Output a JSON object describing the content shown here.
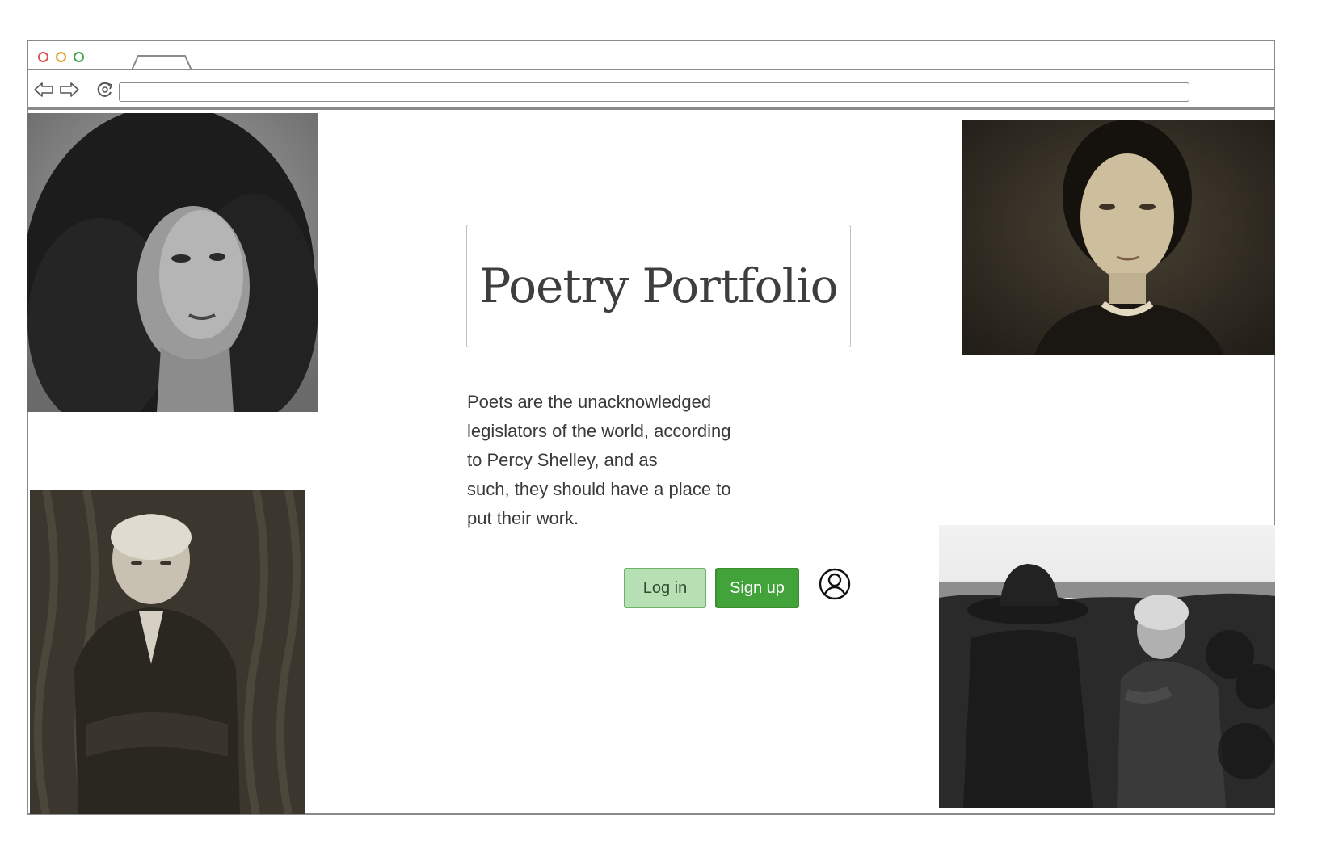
{
  "browser": {
    "window_controls": [
      "close",
      "minimize",
      "maximize"
    ],
    "nav_icons": [
      "back-arrow-icon",
      "forward-arrow-icon",
      "reload-icon"
    ],
    "url": ""
  },
  "hero": {
    "title": "Poetry Portfolio",
    "description_lines": [
      "Poets are the unacknowledged",
      "legislators of the world, according",
      "to Percy Shelley, and as",
      "such, they should have a place to",
      "put their work."
    ]
  },
  "actions": {
    "login_label": "Log in",
    "signup_label": "Sign up",
    "account_icon": "user-circle-icon"
  },
  "photos": [
    {
      "name": "portrait-curly-hair-woman",
      "style": "grayscale"
    },
    {
      "name": "portrait-victorian-woman",
      "style": "sepia"
    },
    {
      "name": "portrait-engraved-man",
      "style": "engraving"
    },
    {
      "name": "photo-man-with-hat-on-rocks",
      "style": "grayscale"
    }
  ],
  "colors": {
    "login_bg": "#b8e0b5",
    "signup_bg": "#43a33b",
    "frame": "#8a8a8a"
  }
}
